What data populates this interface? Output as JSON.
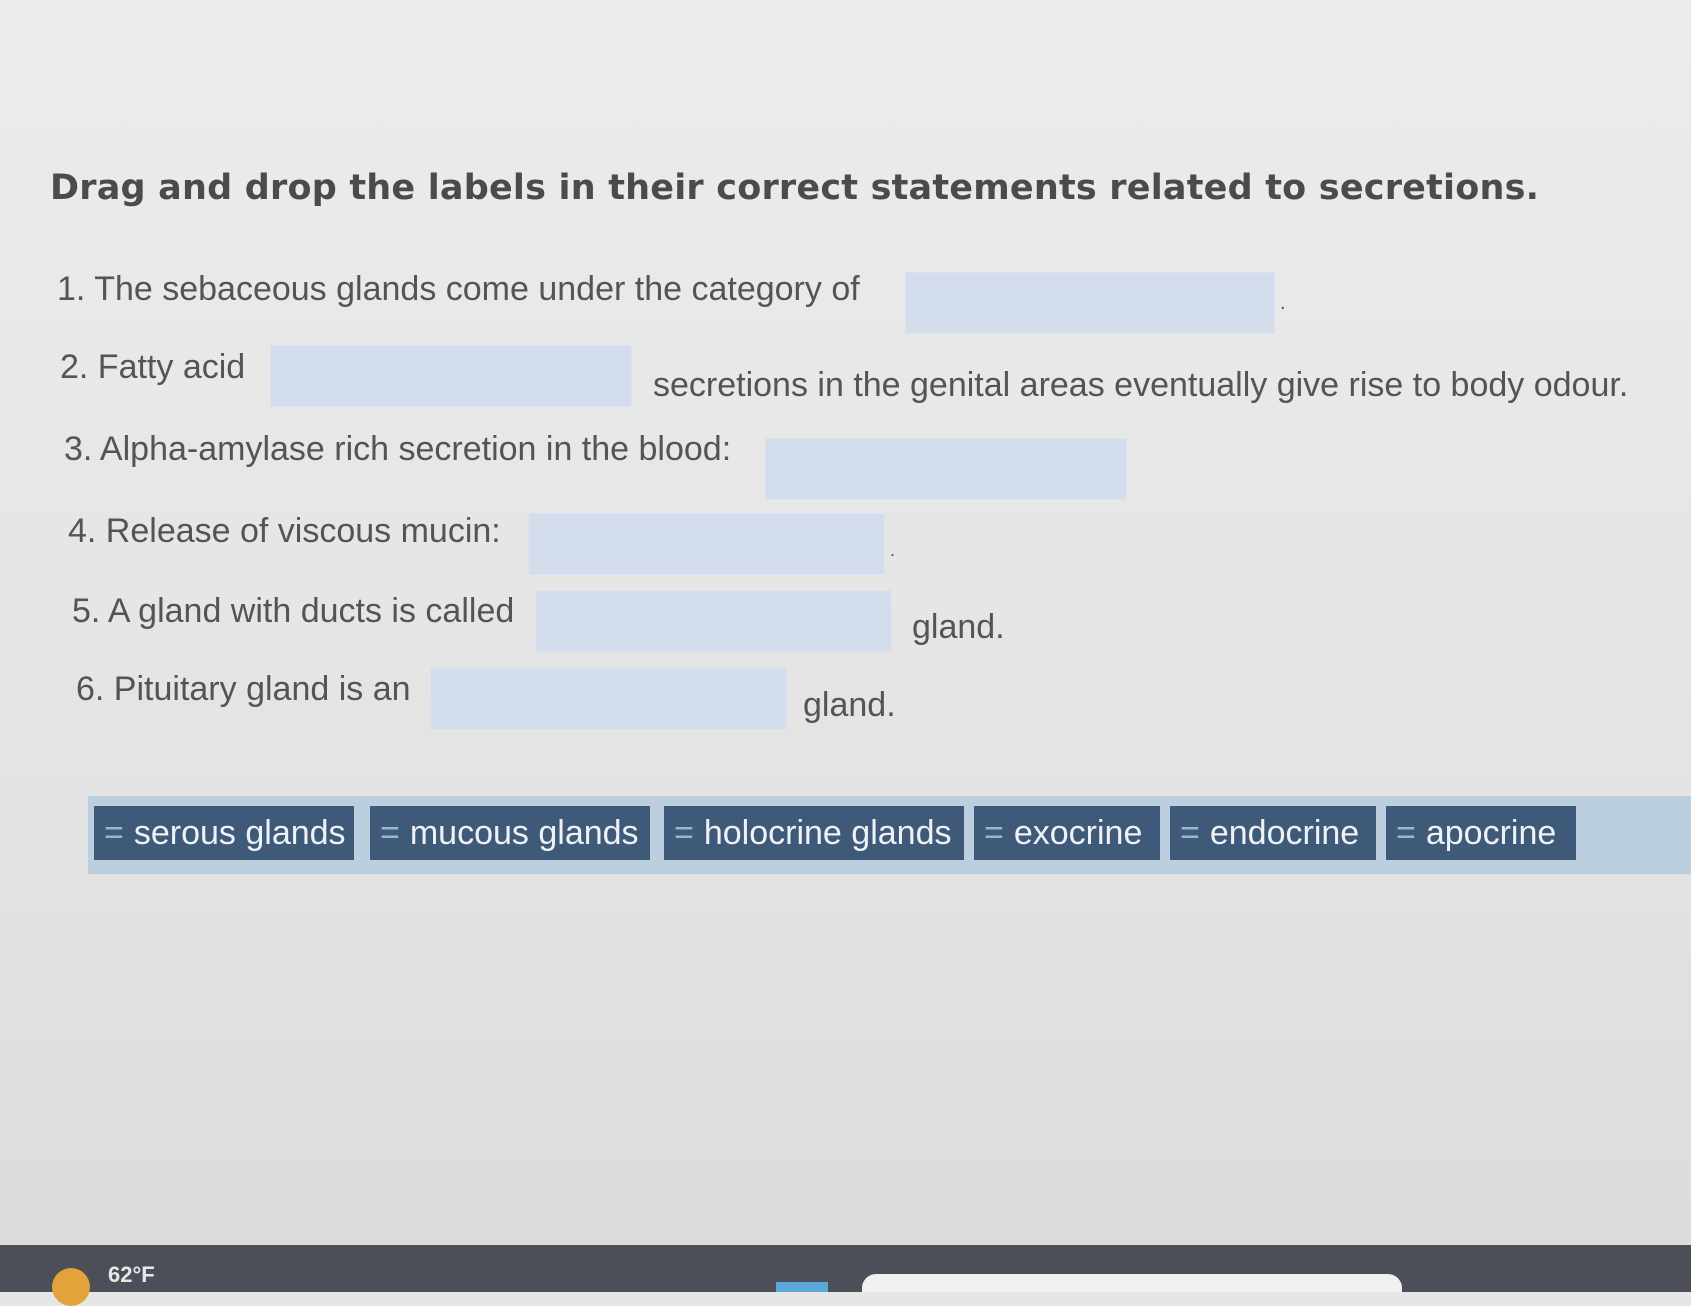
{
  "instruction": "Drag and drop the labels in their correct statements related to secretions.",
  "statements": [
    {
      "before": "1. The sebaceous glands come under the category of",
      "after": "."
    },
    {
      "before": "2. Fatty acid",
      "after": "secretions in the genital areas eventually give rise to body odour."
    },
    {
      "before": "3. Alpha-amylase rich secretion in the blood:",
      "after": ""
    },
    {
      "before": "4. Release of viscous mucin:",
      "after": "."
    },
    {
      "before": "5. A gland with ducts is called",
      "after": "gland."
    },
    {
      "before": "6. Pituitary gland is an",
      "after": "gland."
    }
  ],
  "labels": [
    {
      "grip": "=",
      "text": "serous glands"
    },
    {
      "grip": "=",
      "text": "mucous glands"
    },
    {
      "grip": "=",
      "text": "holocrine glands"
    },
    {
      "grip": "=",
      "text": "exocrine"
    },
    {
      "grip": "=",
      "text": "endocrine"
    },
    {
      "grip": "=",
      "text": "apocrine"
    }
  ],
  "taskbar": {
    "temperature": "62°F"
  },
  "colors": {
    "drop_zone": "#d3ddec",
    "chip": "#3f5a78",
    "bank": "#bccfdf"
  }
}
